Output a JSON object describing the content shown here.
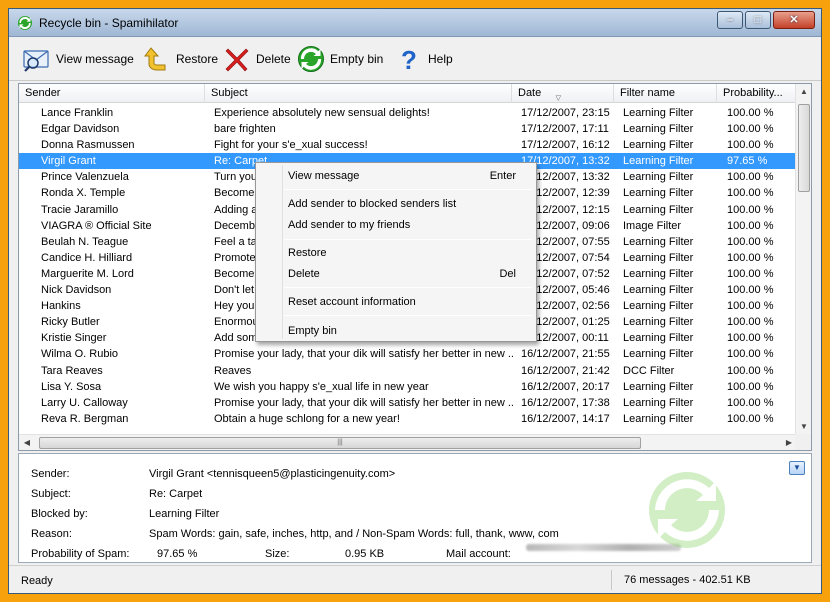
{
  "window": {
    "title": "Recycle bin - Spamihilator",
    "buttons": {
      "minimize": "–",
      "maximize": "□",
      "close": "✕"
    }
  },
  "toolbar": {
    "view_message": "View message",
    "restore": "Restore",
    "delete": "Delete",
    "empty_bin": "Empty bin",
    "help": "Help"
  },
  "list": {
    "columns": [
      "Sender",
      "Subject",
      "Date",
      "Filter name",
      "Probability..."
    ],
    "rows": [
      {
        "sender": "Lance Franklin",
        "subject": "Experience absolutely new sensual delights!",
        "date": "17/12/2007, 23:15",
        "filter": "Learning Filter",
        "prob": "100.00 %"
      },
      {
        "sender": "Edgar Davidson",
        "subject": "bare frighten",
        "date": "17/12/2007, 17:11",
        "filter": "Learning Filter",
        "prob": "100.00 %"
      },
      {
        "sender": "Donna Rasmussen",
        "subject": "Fight for your s'e_xual success!",
        "date": "17/12/2007, 16:12",
        "filter": "Learning Filter",
        "prob": "100.00 %"
      },
      {
        "sender": "Virgil Grant",
        "subject": "Re: Carpet",
        "date": "17/12/2007, 13:32",
        "filter": "Learning Filter",
        "prob": "97.65 %",
        "selected": true
      },
      {
        "sender": "Prince Valenzuela",
        "subject": "Turn you",
        "date": "17/12/2007, 13:32",
        "filter": "Learning Filter",
        "prob": "100.00 %"
      },
      {
        "sender": "Ronda X. Temple",
        "subject": "Become r",
        "date": "17/12/2007, 12:39",
        "filter": "Learning Filter",
        "prob": "100.00 %"
      },
      {
        "sender": "Tracie Jaramillo",
        "subject": "Adding a",
        "date": "17/12/2007, 12:15",
        "filter": "Learning Filter",
        "prob": "100.00 %"
      },
      {
        "sender": "VIAGRA ® Official Site",
        "subject": "Decembe",
        "date": "17/12/2007, 09:06",
        "filter": "Image Filter",
        "prob": "100.00 %"
      },
      {
        "sender": "Beulah N. Teague",
        "subject": "Feel a ta",
        "date": "17/12/2007, 07:55",
        "filter": "Learning Filter",
        "prob": "100.00 %"
      },
      {
        "sender": "Candice H. Hilliard",
        "subject": "Promote",
        "date": "17/12/2007, 07:54",
        "filter": "Learning Filter",
        "prob": "100.00 %"
      },
      {
        "sender": "Marguerite M. Lord",
        "subject": "Become r",
        "date": "17/12/2007, 07:52",
        "filter": "Learning Filter",
        "prob": "100.00 %"
      },
      {
        "sender": "Nick Davidson",
        "subject": "Don't let",
        "date": "17/12/2007, 05:46",
        "filter": "Learning Filter",
        "prob": "100.00 %"
      },
      {
        "sender": "Hankins",
        "subject": "Hey you",
        "date": "17/12/2007, 02:56",
        "filter": "Learning Filter",
        "prob": "100.00 %"
      },
      {
        "sender": "Ricky Butler",
        "subject": "Enormou",
        "date": "17/12/2007, 01:25",
        "filter": "Learning Filter",
        "prob": "100.00 %"
      },
      {
        "sender": "Kristie Singer",
        "subject": "Add som",
        "date": "17/12/2007, 00:11",
        "filter": "Learning Filter",
        "prob": "100.00 %"
      },
      {
        "sender": "Wilma O. Rubio",
        "subject": "Promise your lady, that your dik will satisfy her better in new ...",
        "date": "16/12/2007, 21:55",
        "filter": "Learning Filter",
        "prob": "100.00 %"
      },
      {
        "sender": "Tara Reaves",
        "subject": "Reaves",
        "date": "16/12/2007, 21:42",
        "filter": "DCC Filter",
        "prob": "100.00 %"
      },
      {
        "sender": "Lisa Y. Sosa",
        "subject": "We wish you happy s'e_xual life in new year",
        "date": "16/12/2007, 20:17",
        "filter": "Learning Filter",
        "prob": "100.00 %"
      },
      {
        "sender": "Larry U. Calloway",
        "subject": "Promise your lady, that your dik will satisfy her better in new ...",
        "date": "16/12/2007, 17:38",
        "filter": "Learning Filter",
        "prob": "100.00 %"
      },
      {
        "sender": "Reva R. Bergman",
        "subject": "Obtain a huge schlong for a new year!",
        "date": "16/12/2007, 14:17",
        "filter": "Learning Filter",
        "prob": "100.00 %"
      }
    ]
  },
  "context_menu": {
    "view_message": "View message",
    "view_message_shortcut": "Enter",
    "add_blocked": "Add sender to blocked senders list",
    "add_friends": "Add sender to my friends",
    "restore": "Restore",
    "delete": "Delete",
    "delete_shortcut": "Del",
    "reset_account": "Reset account information",
    "empty_bin": "Empty bin"
  },
  "details": {
    "sender_label": "Sender:",
    "sender_value": "Virgil Grant <tennisqueen5@plasticingenuity.com>",
    "subject_label": "Subject:",
    "subject_value": "Re: Carpet",
    "blocked_label": "Blocked by:",
    "blocked_value": "Learning Filter",
    "reason_label": "Reason:",
    "reason_value": "Spam Words: gain, safe, inches, http, and / Non-Spam Words: full, thank, www, com",
    "probability_label": "Probability of Spam:",
    "probability_value": "97.65 %",
    "size_label": "Size:",
    "size_value": "0.95 KB",
    "account_label": "Mail account:"
  },
  "status": {
    "left": "Ready",
    "right": "76 messages - 402.51 KB"
  },
  "colors": {
    "selection": "#3399ff",
    "desktop": "#f7a20c",
    "recycle_green": "#2aa52a"
  }
}
